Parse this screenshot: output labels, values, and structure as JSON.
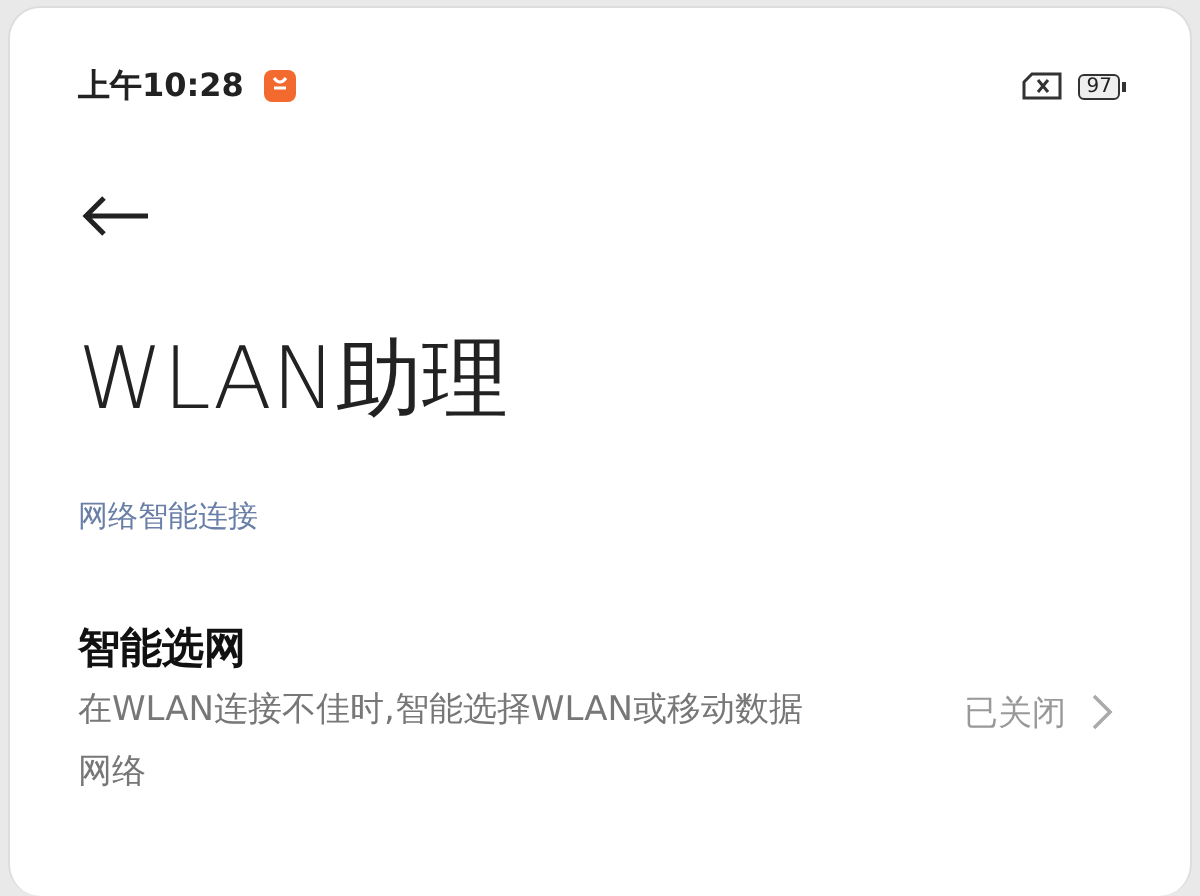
{
  "status_bar": {
    "time": "上午10:28",
    "battery": "97"
  },
  "title": "WLAN助理",
  "section": {
    "header": "网络智能连接",
    "items": [
      {
        "title": "智能选网",
        "description": "在WLAN连接不佳时,智能选择WLAN或移动数据网络",
        "value": "已关闭"
      }
    ]
  }
}
